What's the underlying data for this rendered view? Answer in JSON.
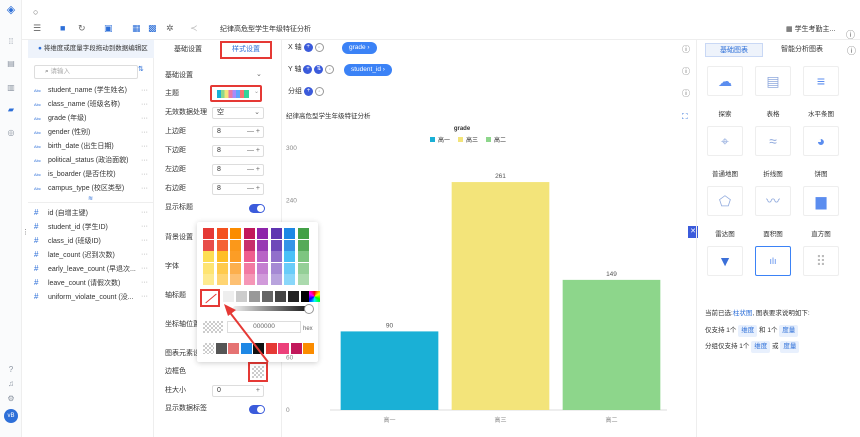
{
  "topbar": {
    "title": "纪律高危型学生年级特征分析",
    "user": "学生考勤主..."
  },
  "fields": {
    "header": "将维度或度量字段拖动到数据编辑区",
    "search_placeholder": "请输入",
    "dimensions": [
      {
        "type": "Abc",
        "name": "student_name (学生姓名)"
      },
      {
        "type": "Abc",
        "name": "class_name (班级名称)"
      },
      {
        "type": "Abc",
        "name": "grade (年级)"
      },
      {
        "type": "Abc",
        "name": "gender (性别)"
      },
      {
        "type": "Abc",
        "name": "birth_date (出生日期)"
      },
      {
        "type": "Abc",
        "name": "political_status (政治面貌)"
      },
      {
        "type": "Abc",
        "name": "is_boarder (是否住校)"
      },
      {
        "type": "Abc",
        "name": "campus_type (校区类型)"
      }
    ],
    "measures": [
      {
        "type": "#",
        "name": "id (自增主键)"
      },
      {
        "type": "#",
        "name": "student_id (学生ID)"
      },
      {
        "type": "#",
        "name": "class_id (班级ID)"
      },
      {
        "type": "#",
        "name": "late_count (迟到次数)"
      },
      {
        "type": "#",
        "name": "early_leave_count (早退次..."
      },
      {
        "type": "#",
        "name": "leave_count (请假次数)"
      },
      {
        "type": "#",
        "name": "uniform_violate_count (没..."
      }
    ]
  },
  "config": {
    "tab_basic": "基础设置",
    "tab_style": "样式设置",
    "labels": {
      "basic": "基础设置",
      "theme": "主题",
      "nodata": "无效数据处理",
      "top": "上边距",
      "bottom": "下边距",
      "left": "左边距",
      "right": "右边距",
      "title_show": "显示标题",
      "bg": "背景设置",
      "font": "字体",
      "axis_title": "轴标题",
      "axis_pos": "坐标轴位置",
      "chart_elem": "图表元素设",
      "border_color": "边框色",
      "col_size": "柱大小",
      "show_label": "显示数据标签"
    },
    "nodata_value": "空",
    "top": "8",
    "bottom": "8",
    "left": "8",
    "right": "8",
    "col_size": "0",
    "pm": "— +",
    "hex_value": "000000",
    "hex_label": "hex"
  },
  "chart": {
    "x_label": "X 轴",
    "y_label": "Y 轴",
    "group_label": "分组",
    "x_pill": "grade",
    "y_pill": "student_id",
    "title": "纪律高危型学生年级特征分析"
  },
  "chart_data": {
    "type": "bar",
    "legend_title": "grade",
    "legend": [
      "高一",
      "高三",
      "高二"
    ],
    "categories": [
      "高一",
      "高三",
      "高二"
    ],
    "values": [
      90,
      261,
      149
    ],
    "colors": [
      "#1ab0d6",
      "#f3e47a",
      "#8dd68b"
    ],
    "yticks": [
      0,
      60,
      240,
      300
    ],
    "ylim": [
      0,
      300
    ]
  },
  "right": {
    "tab_basic": "基础图表",
    "tab_smart": "智能分析图表",
    "charts": [
      "探索",
      "表格",
      "水平条图",
      "普通地图",
      "折线图",
      "饼图",
      "雷达图",
      "面积图",
      "直方图",
      "",
      "",
      ""
    ],
    "current_prefix": "当前已选:",
    "current_type": "柱状图",
    "current_suffix": ", 图表要求说明如下:",
    "req1_a": "仅支持 1个",
    "dim": "维度",
    "req1_b": "和 1个",
    "mea": "度量",
    "req2_a": "分组仅支持 1个",
    "req2_b": "或"
  }
}
